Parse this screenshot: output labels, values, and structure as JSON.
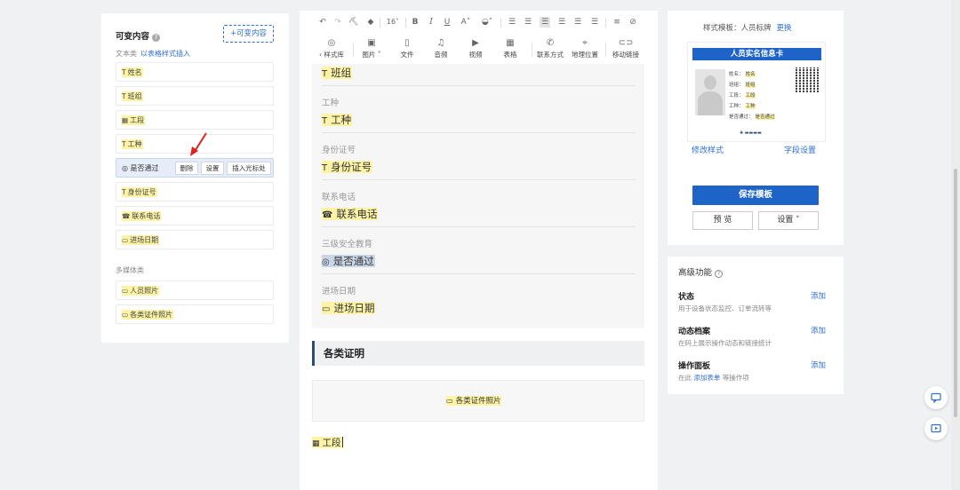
{
  "left_panel": {
    "title": "可变内容",
    "add_button": "+可变内容",
    "section1_label": "文本类",
    "section1_link": "以表格样式插入",
    "fields": [
      {
        "icon": "T",
        "label": "姓名"
      },
      {
        "icon": "T",
        "label": "班组"
      },
      {
        "icon": "▦",
        "label": "工段"
      },
      {
        "icon": "T",
        "label": "工种"
      },
      {
        "icon": "◎",
        "label": "是否通过",
        "active": true
      },
      {
        "icon": "T",
        "label": "身份证号"
      },
      {
        "icon": "☎",
        "label": "联系电话"
      },
      {
        "icon": "▭",
        "label": "进场日期"
      }
    ],
    "active_actions": {
      "delete": "删除",
      "settings": "设置",
      "insert": "插入光标处"
    },
    "section2_label": "多媒体类",
    "media_fields": [
      {
        "icon": "▭",
        "label": "人员照片"
      },
      {
        "icon": "▭",
        "label": "各类证件照片"
      }
    ]
  },
  "toolbar": {
    "font_size": "16",
    "row2": [
      {
        "icon": "palette-icon",
        "glyph": "◎",
        "label": "‹ 样式库"
      },
      {
        "icon": "image-icon",
        "glyph": "▣",
        "label": "图片 ˅"
      },
      {
        "icon": "file-icon",
        "glyph": "▯",
        "label": "文件"
      },
      {
        "icon": "music-icon",
        "glyph": "♫",
        "label": "音频"
      },
      {
        "icon": "video-icon",
        "glyph": "▶",
        "label": "视频"
      },
      {
        "icon": "table-icon",
        "glyph": "▦",
        "label": "表格"
      },
      {
        "icon": "phone-icon",
        "glyph": "✆",
        "label": "联系方式"
      },
      {
        "icon": "location-icon",
        "glyph": "⌖",
        "label": "地理位置"
      },
      {
        "icon": "link-icon",
        "glyph": "⊂⊃",
        "label": "移动链接"
      }
    ]
  },
  "document": {
    "rows": [
      {
        "label": "",
        "icon": "T",
        "value": "班组"
      },
      {
        "label": "工种",
        "icon": "T",
        "value": "工种"
      },
      {
        "label": "身份证号",
        "icon": "T",
        "value": "身份证号"
      },
      {
        "label": "联系电话",
        "icon": "☎",
        "value": "联系电话"
      },
      {
        "label": "三级安全教育",
        "icon": "◎",
        "value": "是否通过"
      },
      {
        "label": "进场日期",
        "icon": "▭",
        "value": "进场日期"
      }
    ],
    "section_heading": "各类证明",
    "photo_placeholder": "各类证件照片",
    "bottom_field": "工段"
  },
  "right_panel": {
    "template_label": "样式模板：人员标牌",
    "change_link": "更换",
    "card": {
      "title": "人员实名信息卡",
      "lines": [
        {
          "k": "姓名：",
          "v": "姓名"
        },
        {
          "k": "班组：",
          "v": "班组"
        },
        {
          "k": "工段：",
          "v": "工段"
        },
        {
          "k": "工种：",
          "v": "工种"
        },
        {
          "k": "是否通过：",
          "v": "是否通过"
        }
      ]
    },
    "modify_style": "修改样式",
    "field_settings": "字段设置",
    "save_button": "保存模板",
    "preview_button": "预 览",
    "settings_button": "设置 ˅"
  },
  "advanced": {
    "title": "高级功能",
    "features": [
      {
        "name": "状态",
        "desc_pre": "用于设备状态监控、订单流转等",
        "desc_link": "",
        "desc_post": "",
        "add": "添加"
      },
      {
        "name": "动态档案",
        "desc_pre": "在码上展示操作动态和链接统计",
        "desc_link": "",
        "desc_post": "",
        "add": "添加"
      },
      {
        "name": "操作面板",
        "desc_pre": "在此 ",
        "desc_link": "添加表单",
        "desc_post": " 等操作项",
        "add": "添加"
      }
    ]
  },
  "colors": {
    "accent": "#1e63c8",
    "highlight": "#fcf3a7",
    "selected": "#c9d6e6"
  }
}
